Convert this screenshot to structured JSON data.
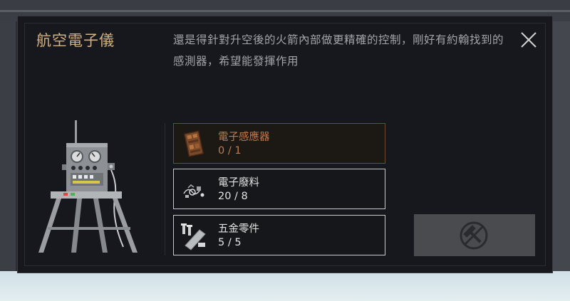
{
  "dialog": {
    "title": "航空電子儀",
    "description": "還是得針對升空後的火箭內部做更精確的控制，剛好有約翰找到的感測器，希望能發揮作用",
    "close_icon": "close-icon",
    "build_button_icon": "hammer-disabled-icon"
  },
  "ingredients": [
    {
      "name": "電子感應器",
      "count": "0 / 1",
      "status": "missing",
      "icon": "circuit-board-icon"
    },
    {
      "name": "電子廢料",
      "count": "20 / 8",
      "status": "ok",
      "icon": "electronic-scrap-icon"
    },
    {
      "name": "五金零件",
      "count": "5 / 5",
      "status": "ok",
      "icon": "hardware-parts-icon"
    }
  ],
  "colors": {
    "title": "#d3b184",
    "missing": "#c07a4e",
    "panel": "#17181d",
    "button_disabled": "#4a4b4f"
  }
}
